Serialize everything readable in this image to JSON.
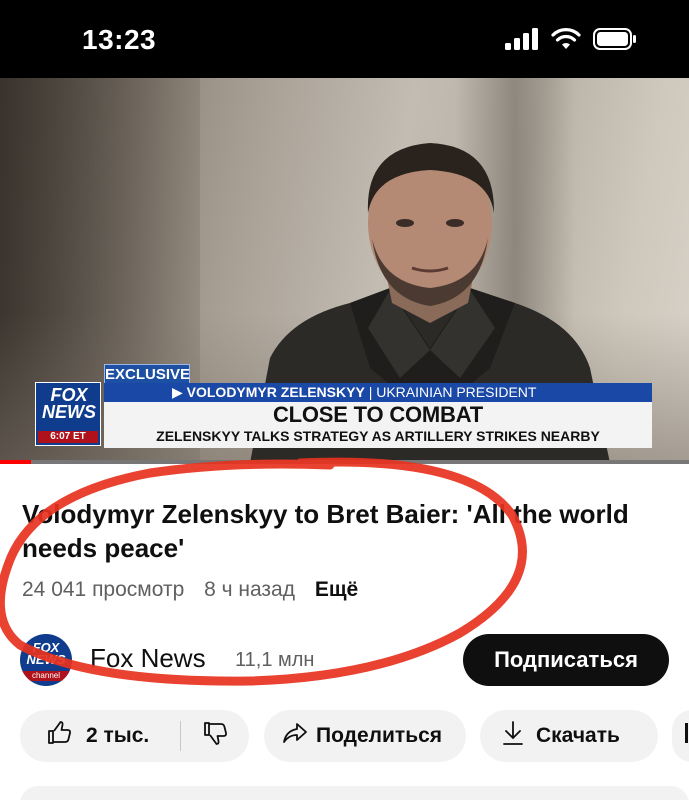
{
  "status_bar": {
    "time": "13:23",
    "icons": [
      "signal-icon",
      "wifi-icon",
      "battery-icon"
    ]
  },
  "video": {
    "chyron": {
      "exclusive_label": "EXCLUSIVE",
      "name": "VOLODYMYR ZELENSKYY",
      "role": "UKRAINIAN PRESIDENT",
      "headline": "CLOSE TO COMBAT",
      "subheadline": "ZELENSKYY TALKS STRATEGY AS ARTILLERY STRIKES NEARBY",
      "logo_text": "FOX NEWS",
      "logo_time": "6:07 ET"
    },
    "progress_fraction": 0.045,
    "progress_color": "#ff0000"
  },
  "title": "Volodymyr Zelenskyy to Bret Baier: 'All the world needs peace'",
  "meta": {
    "views": "24 041 просмотр",
    "age": "8 ч назад",
    "more": "Ещё"
  },
  "channel": {
    "avatar_text": "FOX NEWS",
    "avatar_sub": "channel",
    "name": "Fox News",
    "subscribers": "11,1 млн",
    "subscribe_label": "Подписаться"
  },
  "actions": {
    "likes": "2 тыс.",
    "share_label": "Поделиться",
    "download_label": "Скачать"
  },
  "colors": {
    "accent_red": "#ff0000",
    "annotation_red": "#e8321e",
    "fox_blue": "#0f3c8c",
    "subscribe_bg": "#0f0f0f"
  }
}
